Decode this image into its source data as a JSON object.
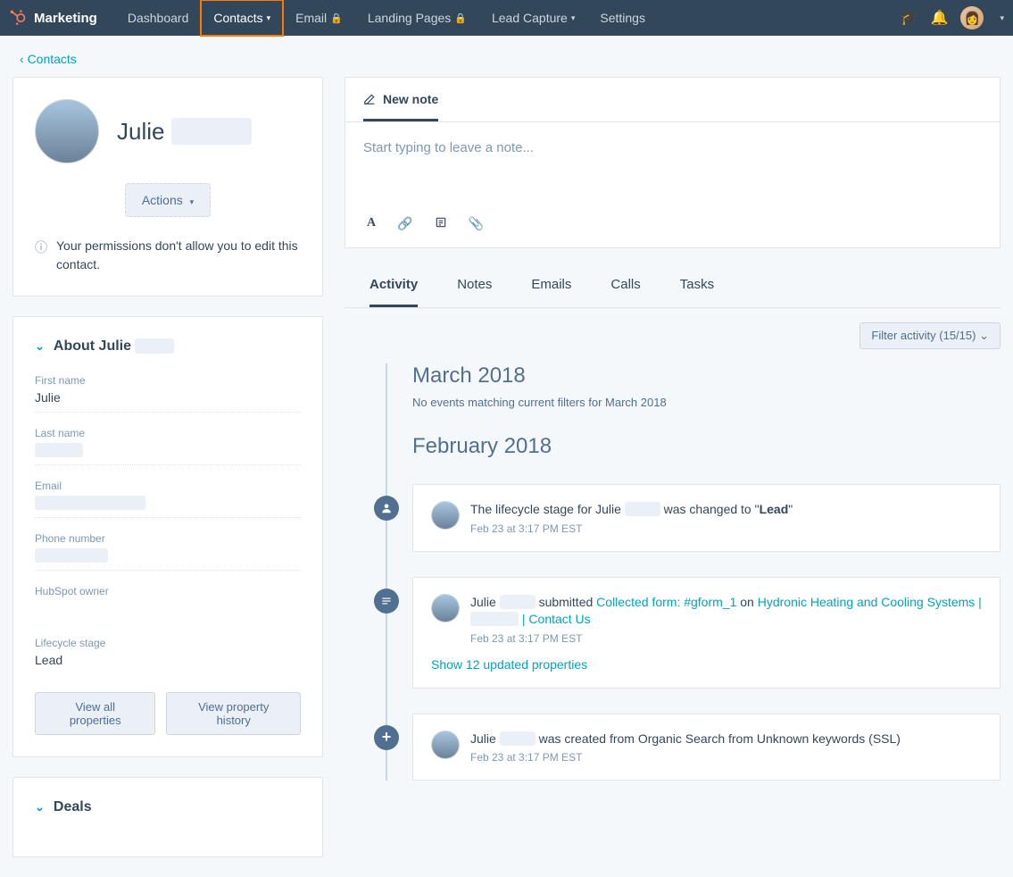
{
  "brand": "Marketing",
  "nav": {
    "items": [
      {
        "label": "Dashboard"
      },
      {
        "label": "Contacts",
        "active": true,
        "caret": true
      },
      {
        "label": "Email",
        "lock": true
      },
      {
        "label": "Landing Pages",
        "lock": true
      },
      {
        "label": "Lead Capture",
        "caret": true
      },
      {
        "label": "Settings"
      }
    ]
  },
  "breadcrumb": "Contacts",
  "contact": {
    "first_name": "Julie",
    "last_name_redacted": "   ",
    "display_name_prefix": "Julie"
  },
  "actions_label": "Actions",
  "permission_notice": "Your permissions don't allow you to edit this contact.",
  "about": {
    "header_prefix": "About Julie",
    "header_redacted": "  ",
    "fields": {
      "first_name_label": "First name",
      "first_name_value": "Julie",
      "last_name_label": "Last name",
      "last_name_value": "",
      "email_label": "Email",
      "email_value": "",
      "phone_label": "Phone number",
      "phone_value": "",
      "owner_label": "HubSpot owner",
      "owner_value": "",
      "lifecycle_label": "Lifecycle stage",
      "lifecycle_value": "Lead"
    },
    "view_all": "View all properties",
    "view_history": "View property history"
  },
  "deals_header": "Deals",
  "note": {
    "tab_label": "New note",
    "placeholder": "Start typing to leave a note..."
  },
  "tabs": [
    "Activity",
    "Notes",
    "Emails",
    "Calls",
    "Tasks"
  ],
  "filter_label": "Filter activity (15/15)",
  "timeline": {
    "march": {
      "heading": "March 2018",
      "empty": "No events matching current filters for March 2018"
    },
    "february": {
      "heading": "February 2018",
      "ev1": {
        "prefix": "The lifecycle stage for ",
        "name": "Julie",
        "redacted": "  ",
        "mid": " was changed to \"",
        "bold": "Lead",
        "suffix": "\"",
        "time": "Feb 23 at 3:17 PM EST"
      },
      "ev2": {
        "name": "Julie",
        "redacted": "  ",
        "action": " submitted ",
        "link1": "Collected form: #gform_1",
        "on": " on ",
        "link2_a": "Hydronic Heating and Cooling Systems | ",
        "link2_redacted": "   ",
        "link2_b": " | Contact Us",
        "time": "Feb 23 at 3:17 PM EST",
        "show_more": "Show 12 updated properties"
      },
      "ev3": {
        "name": "Julie",
        "redacted": "  ",
        "rest": " was created from Organic Search from Unknown keywords (SSL)",
        "time": "Feb 23 at 3:17 PM EST"
      }
    }
  }
}
